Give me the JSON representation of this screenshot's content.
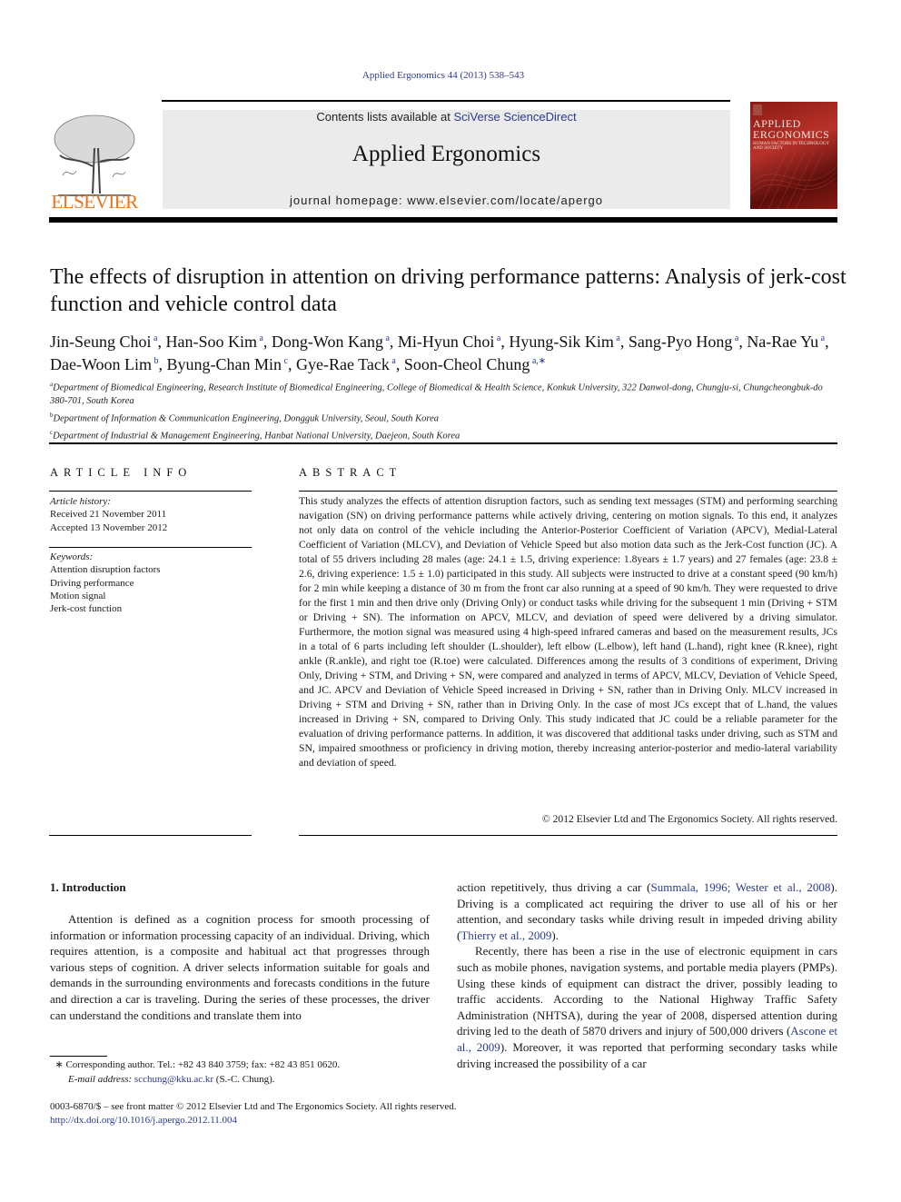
{
  "header": {
    "citation": "Applied Ergonomics 44 (2013) 538–543",
    "contents_prefix": "Contents lists available at ",
    "contents_link": "SciVerse ScienceDirect",
    "journal_title": "Applied Ergonomics",
    "homepage": "journal homepage: www.elsevier.com/locate/apergo",
    "publisher_logo_text": "ELSEVIER",
    "cover": {
      "title_line1": "APPLIED",
      "title_line2": "ERGONOMICS",
      "subtitle": "HUMAN FACTORS IN TECHNOLOGY AND SOCIETY",
      "color": "#8a1a14"
    }
  },
  "article": {
    "title": "The effects of disruption in attention on driving performance patterns: Analysis of jerk-cost function and vehicle control data",
    "authors": [
      {
        "name": "Jin-Seung Choi",
        "aff": "a"
      },
      {
        "name": "Han-Soo Kim",
        "aff": "a"
      },
      {
        "name": "Dong-Won Kang",
        "aff": "a"
      },
      {
        "name": "Mi-Hyun Choi",
        "aff": "a"
      },
      {
        "name": "Hyung-Sik Kim",
        "aff": "a"
      },
      {
        "name": "Sang-Pyo Hong",
        "aff": "a"
      },
      {
        "name": "Na-Rae Yu",
        "aff": "a"
      },
      {
        "name": "Dae-Woon Lim",
        "aff": "b"
      },
      {
        "name": "Byung-Chan Min",
        "aff": "c"
      },
      {
        "name": "Gye-Rae Tack",
        "aff": "a"
      },
      {
        "name": "Soon-Cheol Chung",
        "aff": "a,∗"
      }
    ],
    "affiliations": [
      {
        "key": "a",
        "text": "Department of Biomedical Engineering, Research Institute of Biomedical Engineering, College of Biomedical & Health Science, Konkuk University, 322 Danwol-dong, Chungju-si, Chungcheongbuk-do 380-701, South Korea"
      },
      {
        "key": "b",
        "text": "Department of Information & Communication Engineering, Dongguk University, Seoul, South Korea"
      },
      {
        "key": "c",
        "text": "Department of Industrial & Management Engineering, Hanbat National University, Daejeon, South Korea"
      }
    ]
  },
  "article_info": {
    "heading": "ARTICLE INFO",
    "history_label": "Article history:",
    "received": "Received 21 November 2011",
    "accepted": "Accepted 13 November 2012",
    "keywords_label": "Keywords:",
    "keywords": [
      "Attention disruption factors",
      "Driving performance",
      "Motion signal",
      "Jerk-cost function"
    ]
  },
  "abstract": {
    "heading": "ABSTRACT",
    "text": "This study analyzes the effects of attention disruption factors, such as sending text messages (STM) and performing searching navigation (SN) on driving performance patterns while actively driving, centering on motion signals. To this end, it analyzes not only data on control of the vehicle including the Anterior-Posterior Coefficient of Variation (APCV), Medial-Lateral Coefficient of Variation (MLCV), and Deviation of Vehicle Speed but also motion data such as the Jerk-Cost function (JC). A total of 55 drivers including 28 males (age: 24.1 ± 1.5, driving experience: 1.8years ± 1.7 years) and 27 females (age: 23.8 ± 2.6, driving experience: 1.5 ± 1.0) participated in this study. All subjects were instructed to drive at a constant speed (90 km/h) for 2 min while keeping a distance of 30 m from the front car also running at a speed of 90 km/h. They were requested to drive for the first 1 min and then drive only (Driving Only) or conduct tasks while driving for the subsequent 1 min (Driving + STM or Driving + SN). The information on APCV, MLCV, and deviation of speed were delivered by a driving simulator. Furthermore, the motion signal was measured using 4 high-speed infrared cameras and based on the measurement results, JCs in a total of 6 parts including left shoulder (L.shoulder), left elbow (L.elbow), left hand (L.hand), right knee (R.knee), right ankle (R.ankle), and right toe (R.toe) were calculated. Differences among the results of 3 conditions of experiment, Driving Only, Driving + STM, and Driving + SN, were compared and analyzed in terms of APCV, MLCV, Deviation of Vehicle Speed, and JC. APCV and Deviation of Vehicle Speed increased in Driving + SN, rather than in Driving Only. MLCV increased in Driving + STM and Driving + SN, rather than in Driving Only. In the case of most JCs except that of L.hand, the values increased in Driving + SN, compared to Driving Only. This study indicated that JC could be a reliable parameter for the evaluation of driving performance patterns. In addition, it was discovered that additional tasks under driving, such as STM and SN, impaired smoothness or proficiency in driving motion, thereby increasing anterior-posterior and medio-lateral variability and deviation of speed.",
    "copyright": "© 2012 Elsevier Ltd and The Ergonomics Society. All rights reserved."
  },
  "introduction": {
    "heading": "1.  Introduction",
    "para1": "Attention is defined as a cognition process for smooth processing of information or information processing capacity of an individual. Driving, which requires attention, is a composite and habitual act that progresses through various steps of cognition. A driver selects information suitable for goals and demands in the surrounding environments and forecasts conditions in the future and direction a car is traveling. During the series of these processes, the driver can understand the conditions and translate them into",
    "col2_p1_a": "action repetitively, thus driving a car (",
    "ref1": "Summala, 1996; Wester et al., 2008",
    "col2_p1_b": "). Driving is a complicated act requiring the driver to use all of his or her attention, and secondary tasks while driving result in impeded driving ability (",
    "ref2": "Thierry et al., 2009",
    "col2_p1_c": ").",
    "col2_p2_a": "Recently, there has been a rise in the use of electronic equipment in cars such as mobile phones, navigation systems, and portable media players (PMPs). Using these kinds of equipment can distract the driver, possibly leading to traffic accidents. According to the National Highway Traffic Safety Administration (NHTSA), during the year of 2008, dispersed attention during driving led to the death of 5870 drivers and injury of 500,000 drivers (",
    "ref3": "Ascone et al., 2009",
    "col2_p2_b": "). Moreover, it was reported that performing secondary tasks while driving increased the possibility of a car"
  },
  "footnote": {
    "marker": "∗",
    "corresponding": " Corresponding author. Tel.: +82 43 840 3759; fax: +82 43 851 0620.",
    "email_label": "E-mail address:",
    "email": "scchung@kku.ac.kr",
    "email_suffix": " (S.-C. Chung)."
  },
  "footer": {
    "issn_line": "0003-6870/$ – see front matter © 2012 Elsevier Ltd and The Ergonomics Society. All rights reserved.",
    "doi": "http://dx.doi.org/10.1016/j.apergo.2012.11.004"
  }
}
